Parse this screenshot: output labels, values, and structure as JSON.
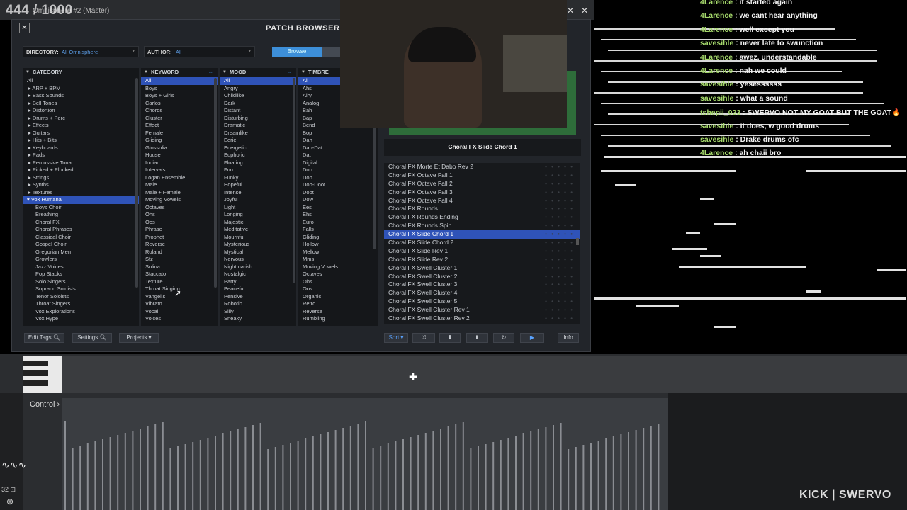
{
  "overlay": {
    "counter": "444 / 1000",
    "brand": "KICK | SWERVO"
  },
  "window": {
    "title": "Omnisphere #2 (Master)"
  },
  "patch_browser": {
    "title": "PATCH BROWSER",
    "directory_label": "DIRECTORY:",
    "directory_value": "All Omnisphere",
    "author_label": "AUTHOR:",
    "author_value": "All",
    "browse_label": "Browse",
    "columns": {
      "category": {
        "header": "CATEGORY",
        "items": [
          "All",
          "▸ ARP + BPM",
          "▸ Bass Sounds",
          "▸ Bell Tones",
          "▸ Distortion",
          "▸ Drums + Perc",
          "▸ Effects",
          "▸ Guitars",
          "▸ Hits + Bits",
          "▸ Keyboards",
          "▸ Pads",
          "▸ Percussive Tonal",
          "▸ Picked + Plucked",
          "▸ Strings",
          "▸ Synths",
          "▸ Textures",
          "▾ Vox Humana",
          "Boys Choir",
          "Breathing",
          "Choral FX",
          "Choral Phrases",
          "Classical Choir",
          "Gospel Choir",
          "Gregorian Men",
          "Growlers",
          "Jazz Voices",
          "Pop Stacks",
          "Solo Singers",
          "Soprano Soloists",
          "Tenor Soloists",
          "Throat Singers",
          "Vox Explorations",
          "Vox Hype"
        ],
        "selected_index": 16
      },
      "keyword": {
        "header": "KEYWORD",
        "items": [
          "All",
          "Boys",
          "Boys + Girls",
          "Carlos",
          "Chords",
          "Cluster",
          "Effect",
          "Female",
          "Gliding",
          "Glossolia",
          "House",
          "Indian",
          "Intervals",
          "Logan Ensemble",
          "Male",
          "Male + Female",
          "Moving Vowels",
          "Octaves",
          "Ohs",
          "Oos",
          "Phrase",
          "Prophet",
          "Reverse",
          "Roland",
          "Sfz",
          "Solina",
          "Staccato",
          "Texture",
          "Throat Singing",
          "Vangelis",
          "Vibrato",
          "Vocal",
          "Voices"
        ],
        "selected_index": 0
      },
      "mood": {
        "header": "MOOD",
        "items": [
          "All",
          "Angry",
          "Childlike",
          "Dark",
          "Distant",
          "Disturbing",
          "Dramatic",
          "Dreamlike",
          "Eerie",
          "Energetic",
          "Euphoric",
          "Floating",
          "Fun",
          "Funky",
          "Hopeful",
          "Intense",
          "Joyful",
          "Light",
          "Longing",
          "Majestic",
          "Meditative",
          "Mournful",
          "Mysterious",
          "Mystical",
          "Nervous",
          "Nightmarish",
          "Nostalgic",
          "Party",
          "Peaceful",
          "Pensive",
          "Robotic",
          "Silly",
          "Sneaky"
        ],
        "selected_index": 0
      },
      "timbre": {
        "header": "TIMBRE",
        "items": [
          "All",
          "Ahs",
          "Airy",
          "Analog",
          "Bah",
          "Bap",
          "Bend",
          "Bop",
          "Dah",
          "Dah-Dat",
          "Dat",
          "Digital",
          "Doh",
          "Doo",
          "Doo-Doot",
          "Doot",
          "Dow",
          "Ees",
          "Ehs",
          "Euro",
          "Falls",
          "Gliding",
          "Hollow",
          "Mellow",
          "Mms",
          "Moving Vowels",
          "Octaves",
          "Ohs",
          "Oos",
          "Organic",
          "Retro",
          "Reverse",
          "Rumbling"
        ],
        "selected_index": 0
      }
    },
    "preview_name": "Choral FX Slide Chord 1",
    "patches": [
      "Choral FX Morte Et Dabo Rev 2",
      "Choral FX Octave Fall 1",
      "Choral FX Octave Fall 2",
      "Choral FX Octave Fall 3",
      "Choral FX Octave Fall 4",
      "Choral FX Rounds",
      "Choral FX Rounds Ending",
      "Choral FX Rounds Spin",
      "Choral FX Slide Chord 1",
      "Choral FX Slide Chord 2",
      "Choral FX Slide Rev 1",
      "Choral FX Slide Rev 2",
      "Choral FX Swell Cluster 1",
      "Choral FX Swell Cluster 2",
      "Choral FX Swell Cluster 3",
      "Choral FX Swell Cluster 4",
      "Choral FX Swell Cluster 5",
      "Choral FX Swell Cluster Rev 1",
      "Choral FX Swell Cluster Rev 2"
    ],
    "selected_patch_index": 8,
    "buttons": {
      "edit_tags": "Edit Tags",
      "settings": "Settings",
      "projects": "Projects ▾",
      "sort": "Sort ▾",
      "info": "Info"
    }
  },
  "daw": {
    "control_label": "Control",
    "bpm": "32"
  },
  "chat": [
    {
      "user": "4Larence",
      "msg": "it started again"
    },
    {
      "user": "4Larence",
      "msg": "we cant hear anything"
    },
    {
      "user": "4Larence",
      "msg": "well except you"
    },
    {
      "user": "savesihle",
      "msg": "never late to swunction"
    },
    {
      "user": "4Larence",
      "msg": "awez, understandable"
    },
    {
      "user": "4Larence",
      "msg": "nah we could"
    },
    {
      "user": "savesihle",
      "msg": "yesessssss"
    },
    {
      "user": "savesihle",
      "msg": "what a sound"
    },
    {
      "user": "tshepii_023",
      "msg": "SWERVO NOT MY GOAT BUT THE GOAT🔥"
    },
    {
      "user": "savesihle",
      "msg": "it does, w good drums"
    },
    {
      "user": "savesihle",
      "msg": "Drake drums ofc"
    },
    {
      "user": "4Larence",
      "msg": "ah chaii bro"
    }
  ]
}
